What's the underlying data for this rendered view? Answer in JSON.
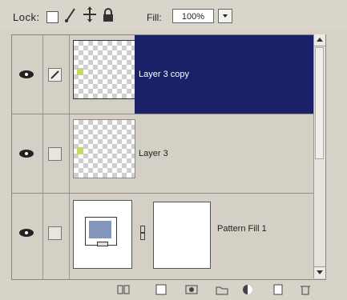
{
  "toolbar": {
    "lock_label": "Lock:",
    "fill_label": "Fill:",
    "fill_value": "100%",
    "icons": [
      "lock-transparent-icon",
      "lock-image-icon",
      "lock-position-icon",
      "lock-all-icon"
    ]
  },
  "layers": [
    {
      "name": "Layer 3 copy",
      "visible": true,
      "selected": true,
      "linked": true
    },
    {
      "name": "Layer 3",
      "visible": true,
      "selected": false,
      "linked": false
    },
    {
      "name": "Pattern Fill 1",
      "visible": true,
      "selected": false,
      "linked": false
    }
  ],
  "bottom_toolbar": {
    "icons": [
      "link-layers-icon",
      "layer-style-icon",
      "add-mask-icon",
      "new-group-icon",
      "adjustment-layer-icon",
      "new-layer-icon",
      "trash-icon"
    ]
  },
  "colors": {
    "selection": "#1a2169",
    "pattern_swatch": "#8596bd",
    "layer_thumb_dot": "#c8d66b"
  }
}
